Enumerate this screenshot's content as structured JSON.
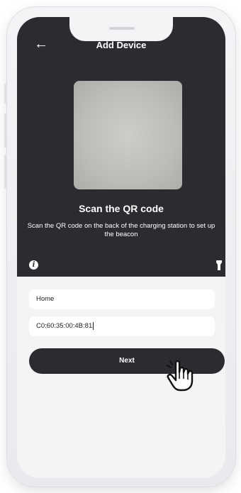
{
  "header": {
    "title": "Add Device",
    "back_icon": "←"
  },
  "scanner": {
    "heading": "Scan the QR code",
    "description": "Scan the QR code on the back of the charging station to set up the beacon",
    "info_icon": "i"
  },
  "form": {
    "name_value": "Home",
    "mac_value": "C0:60:35:00:4B:81",
    "next_label": "Next"
  },
  "icons": {
    "info": "info-icon",
    "flashlight": "flashlight-icon",
    "cursor": "pointing-hand-cursor-icon"
  },
  "colors": {
    "dark": "#2b2c30",
    "sheet": "#f4f4f4"
  }
}
